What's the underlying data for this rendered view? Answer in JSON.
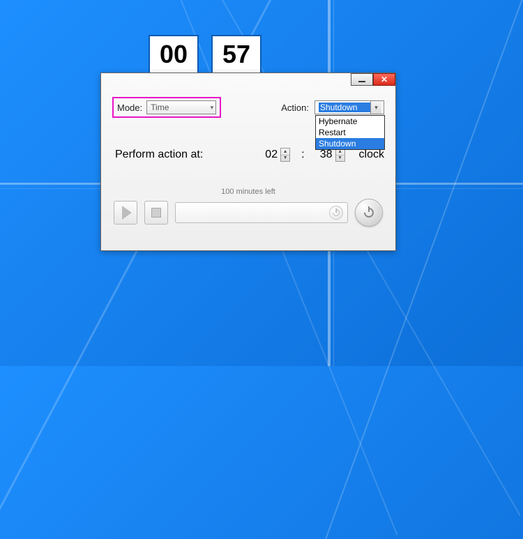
{
  "clock": {
    "hours": "00",
    "minutes": "57"
  },
  "window": {
    "mode_label": "Mode:",
    "mode_value": "Time",
    "action_label": "Action:",
    "action_value": "Shutdown",
    "action_options": [
      "Hybernate",
      "Restart",
      "Shutdown"
    ],
    "perform_label": "Perform action at:",
    "time_hour": "02",
    "time_minute": "38",
    "time_unit": "clock",
    "status_text": "100 minutes left"
  },
  "icons": {
    "play": "play-icon",
    "stop": "stop-icon",
    "power_small": "power-icon",
    "power_big": "power-icon"
  }
}
